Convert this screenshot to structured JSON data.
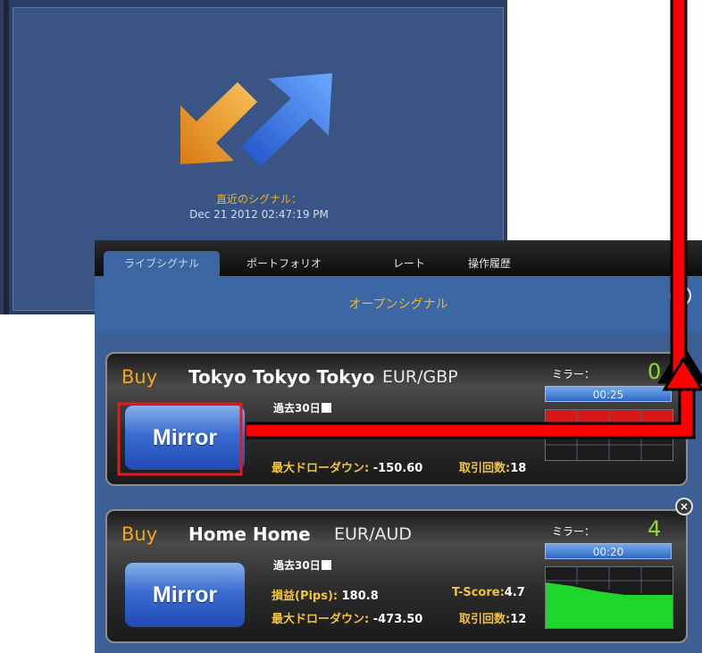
{
  "background": {
    "recent_signal_label": "直近のシグナル：",
    "recent_signal_time": "Dec 21 2012 02:47:19 PM",
    "icon": "swap-arrows-icon"
  },
  "tabs": [
    {
      "label": "ライブシグナル",
      "active": true
    },
    {
      "label": "ポートフォリオ",
      "active": false
    },
    {
      "label": "レート",
      "active": false
    },
    {
      "label": "操作履歴",
      "active": false
    }
  ],
  "header": {
    "title": "オープンシグナル"
  },
  "cards": [
    {
      "direction": "Buy",
      "name": "Tokyo Tokyo Tokyo",
      "pair": "EUR/GBP",
      "mirror_label": "ミラー：",
      "mirror_count": "0",
      "period_label": "過去30日",
      "timer": "00:25",
      "button_label": "Mirror",
      "max_drawdown_label": "最大ドローダウン:",
      "max_drawdown_value": "-150.60",
      "trades_label": "取引回数:",
      "trades_value": "18"
    },
    {
      "direction": "Buy",
      "name": "Home Home",
      "pair": "EUR/AUD",
      "mirror_label": "ミラー：",
      "mirror_count": "4",
      "period_label": "過去30日",
      "timer": "00:20",
      "button_label": "Mirror",
      "pl_label": "損益(Pips):",
      "pl_value": "180.8",
      "tscore_label": "T-Score:",
      "tscore_value": "4.7",
      "max_drawdown_label": "最大ドローダウン:",
      "max_drawdown_value": "-473.50",
      "trades_label": "取引回数:",
      "trades_value": "12"
    }
  ],
  "colors": {
    "accent": "#f1b722",
    "panel": "#3e5f93",
    "annotation_red": "#ff0000",
    "mirror_green": "#8cd932"
  }
}
